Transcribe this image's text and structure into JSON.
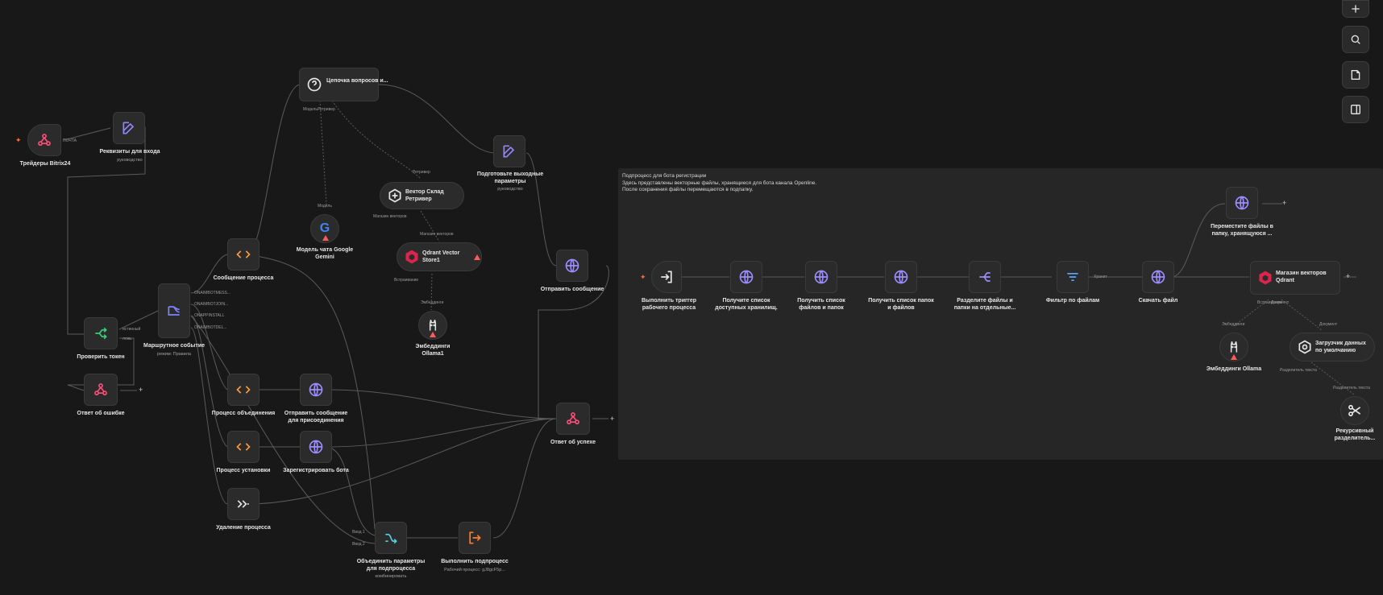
{
  "sticky_note": {
    "text": "Подпроцесс для бота регистрации\nЗдесь представлены векторные файлы, хранящиеся для бота канала Openline.\nПосле сохранения файлы перемещаются в подпапку."
  },
  "nodes": {
    "triggers_bitrix": {
      "label": "Трейдеры Bitrix24",
      "port": "ПОЧТА"
    },
    "login_details": {
      "label": "Реквизиты для входа",
      "sub": "руководство"
    },
    "chain_questions": {
      "label": "Цепочка вопросов и...",
      "port_model": "Модель",
      "port_retriever": "Ретривер"
    },
    "prepare_output": {
      "label": "Подготовьте выходные параметры",
      "sub": "руководство"
    },
    "vector_retriever": {
      "label": "Вектор Склад Ретривер",
      "port_top": "Ретривер",
      "port_bottom": "Магазин векторов"
    },
    "gemini_model": {
      "label": "Модель чата Google Gemini",
      "port": "Модель"
    },
    "qdrant_store1": {
      "label": "Qdrant Vector Store1",
      "port_top": "Магазин векторов",
      "port_bottom": "Встраивание"
    },
    "ollama1": {
      "label": "Эмбеддинги Ollama1",
      "port": "Эмбеддинги"
    },
    "process_message": {
      "label": "Сообщение процесса"
    },
    "send_message": {
      "label": "Отправить сообщение"
    },
    "router": {
      "label": "Маршрутное событие",
      "sub": "режим: Правила",
      "outputs": [
        "ONAIMBOTMESS...",
        "ONAIMBOTJOIN...",
        "ONAPPINSTALL",
        "ONAIMBOTDEL..."
      ]
    },
    "check_token": {
      "label": "Проверить токен",
      "port_true": "истинный",
      "port_false": "ложь"
    },
    "error_response": {
      "label": "Ответ об ошибке"
    },
    "merge_process": {
      "label": "Процесс объединения"
    },
    "send_join_message": {
      "label": "Отправить сообщение для присоединения"
    },
    "install_process": {
      "label": "Процесс установки"
    },
    "register_bot": {
      "label": "Зарегистрировать бота"
    },
    "delete_process": {
      "label": "Удаление процесса"
    },
    "success_response": {
      "label": "Ответ об успехе"
    },
    "merge_params": {
      "label": "Объединить параметры для подпроцесса",
      "sub": "комбинировать",
      "port1": "Ввод 1",
      "port2": "Ввод 2"
    },
    "run_subprocess": {
      "label": "Выполнить подпроцесс",
      "sub": "Рабочий процесс: gJ8gcF5p..."
    },
    "wf_trigger": {
      "label": "Выполнить триггер рабочего процесса"
    },
    "get_storages": {
      "label": "Получите список доступных хранилищ."
    },
    "get_files_folders": {
      "label": "Получить список файлов и папок"
    },
    "get_folders_files": {
      "label": "Получить список папок и файлов"
    },
    "split_files": {
      "label": "Разделите файлы и папки на отдельные..."
    },
    "filter_files": {
      "label": "Фильтр по файлам",
      "port": "Хранит"
    },
    "download_file": {
      "label": "Скачать файл"
    },
    "move_files": {
      "label": "Переместите файлы в папку, хранящуюся ..."
    },
    "qdrant_store": {
      "label": "Магазин векторов Qdrant",
      "port_embed": "Встраивание",
      "port_doc": "Документ"
    },
    "ollama": {
      "label": "Эмбеддинги Ollama",
      "port": "Эмбеддинги"
    },
    "default_loader": {
      "label": "Загрузчик данных по умолчанию",
      "port_doc": "Документ",
      "port_split": "Разделитель текста"
    },
    "recursive_splitter": {
      "label": "Рекурсивный разделитель...",
      "port": "Разделитель текста"
    }
  },
  "toolbar": {
    "buttons": [
      "plus-icon",
      "search-icon",
      "sticky-note-icon",
      "sidebar-toggle-icon"
    ]
  },
  "colors": {
    "background": "#181818",
    "node": "#2b2b2b",
    "webhook": "#ff4d7a",
    "edit": "#8f87ff",
    "code": "#ff9a3c",
    "globe": "#9b8cff",
    "router": "#7b86ff",
    "branch": "#33d17a",
    "qdrant": "#dc244c",
    "warning": "#ff5a5a"
  }
}
